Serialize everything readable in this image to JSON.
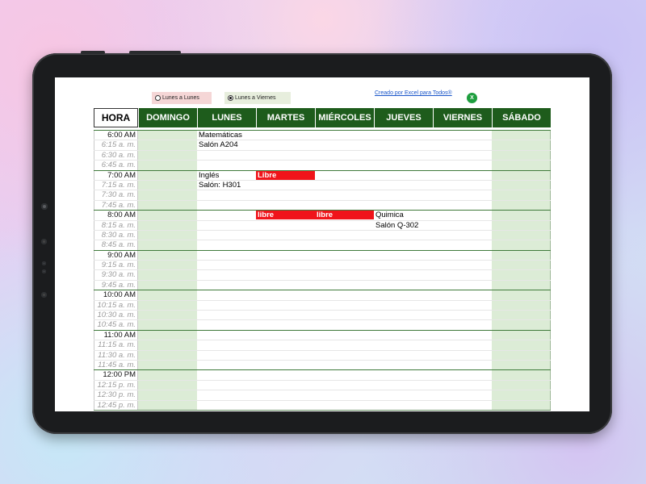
{
  "options": {
    "opt1": "Lunes a Lunes",
    "opt2": "Lunes a Viernes",
    "selected": "opt2"
  },
  "credit": "Creado por Excel para Todos®",
  "header": {
    "hora": "HORA",
    "days": [
      "DOMINGO",
      "LUNES",
      "MARTES",
      "MIÉRCOLES",
      "JUEVES",
      "VIERNES",
      "SÁBADO"
    ]
  },
  "rows": [
    {
      "time": "6:00 AM",
      "type": "hour",
      "cells": [
        "",
        "Matemáticas",
        "",
        "",
        "",
        "",
        ""
      ]
    },
    {
      "time": "6:15 a. m.",
      "type": "q",
      "cells": [
        "",
        "Salón A204",
        "",
        "",
        "",
        "",
        ""
      ]
    },
    {
      "time": "6:30 a. m.",
      "type": "q",
      "cells": [
        "",
        "",
        "",
        "",
        "",
        "",
        ""
      ]
    },
    {
      "time": "6:45 a. m.",
      "type": "q",
      "cells": [
        "",
        "",
        "",
        "",
        "",
        "",
        ""
      ]
    },
    {
      "time": "7:00 AM",
      "type": "hour",
      "cells": [
        "",
        "Inglés",
        "Libre",
        "",
        "",
        "",
        ""
      ],
      "red": [
        2
      ]
    },
    {
      "time": "7:15 a. m.",
      "type": "q",
      "cells": [
        "",
        "Salón: H301",
        "",
        "",
        "",
        "",
        ""
      ]
    },
    {
      "time": "7:30 a. m.",
      "type": "q",
      "cells": [
        "",
        "",
        "",
        "",
        "",
        "",
        ""
      ]
    },
    {
      "time": "7:45 a. m.",
      "type": "q",
      "cells": [
        "",
        "",
        "",
        "",
        "",
        "",
        ""
      ]
    },
    {
      "time": "8:00 AM",
      "type": "hour",
      "cells": [
        "",
        "",
        "libre",
        "libre",
        "Quimica",
        "",
        ""
      ],
      "red": [
        2,
        3
      ]
    },
    {
      "time": "8:15 a. m.",
      "type": "q",
      "cells": [
        "",
        "",
        "",
        "",
        "Salón Q-302",
        "",
        ""
      ]
    },
    {
      "time": "8:30 a. m.",
      "type": "q",
      "cells": [
        "",
        "",
        "",
        "",
        "",
        "",
        ""
      ]
    },
    {
      "time": "8:45 a. m.",
      "type": "q",
      "cells": [
        "",
        "",
        "",
        "",
        "",
        "",
        ""
      ]
    },
    {
      "time": "9:00 AM",
      "type": "hour",
      "cells": [
        "",
        "",
        "",
        "",
        "",
        "",
        ""
      ]
    },
    {
      "time": "9:15 a. m.",
      "type": "q",
      "cells": [
        "",
        "",
        "",
        "",
        "",
        "",
        ""
      ]
    },
    {
      "time": "9:30 a. m.",
      "type": "q",
      "cells": [
        "",
        "",
        "",
        "",
        "",
        "",
        ""
      ]
    },
    {
      "time": "9:45 a. m.",
      "type": "q",
      "cells": [
        "",
        "",
        "",
        "",
        "",
        "",
        ""
      ]
    },
    {
      "time": "10:00 AM",
      "type": "hour",
      "cells": [
        "",
        "",
        "",
        "",
        "",
        "",
        ""
      ]
    },
    {
      "time": "10:15 a. m.",
      "type": "q",
      "cells": [
        "",
        "",
        "",
        "",
        "",
        "",
        ""
      ]
    },
    {
      "time": "10:30 a. m.",
      "type": "q",
      "cells": [
        "",
        "",
        "",
        "",
        "",
        "",
        ""
      ]
    },
    {
      "time": "10:45 a. m.",
      "type": "q",
      "cells": [
        "",
        "",
        "",
        "",
        "",
        "",
        ""
      ]
    },
    {
      "time": "11:00 AM",
      "type": "hour",
      "cells": [
        "",
        "",
        "",
        "",
        "",
        "",
        ""
      ]
    },
    {
      "time": "11:15 a. m.",
      "type": "q",
      "cells": [
        "",
        "",
        "",
        "",
        "",
        "",
        ""
      ]
    },
    {
      "time": "11:30 a. m.",
      "type": "q",
      "cells": [
        "",
        "",
        "",
        "",
        "",
        "",
        ""
      ]
    },
    {
      "time": "11:45 a. m.",
      "type": "q",
      "cells": [
        "",
        "",
        "",
        "",
        "",
        "",
        ""
      ]
    },
    {
      "time": "12:00 PM",
      "type": "hour",
      "cells": [
        "",
        "",
        "",
        "",
        "",
        "",
        ""
      ]
    },
    {
      "time": "12:15 p. m.",
      "type": "q",
      "cells": [
        "",
        "",
        "",
        "",
        "",
        "",
        ""
      ]
    },
    {
      "time": "12:30 p. m.",
      "type": "q",
      "cells": [
        "",
        "",
        "",
        "",
        "",
        "",
        ""
      ]
    },
    {
      "time": "12:45 p. m.",
      "type": "q",
      "cells": [
        "",
        "",
        "",
        "",
        "",
        "",
        ""
      ]
    }
  ],
  "colors": {
    "header_bg": "#1e5c1c",
    "weekend_bg": "#dcecd6",
    "event_red": "#f0141a"
  },
  "icons": {
    "excel": "excel-icon"
  }
}
